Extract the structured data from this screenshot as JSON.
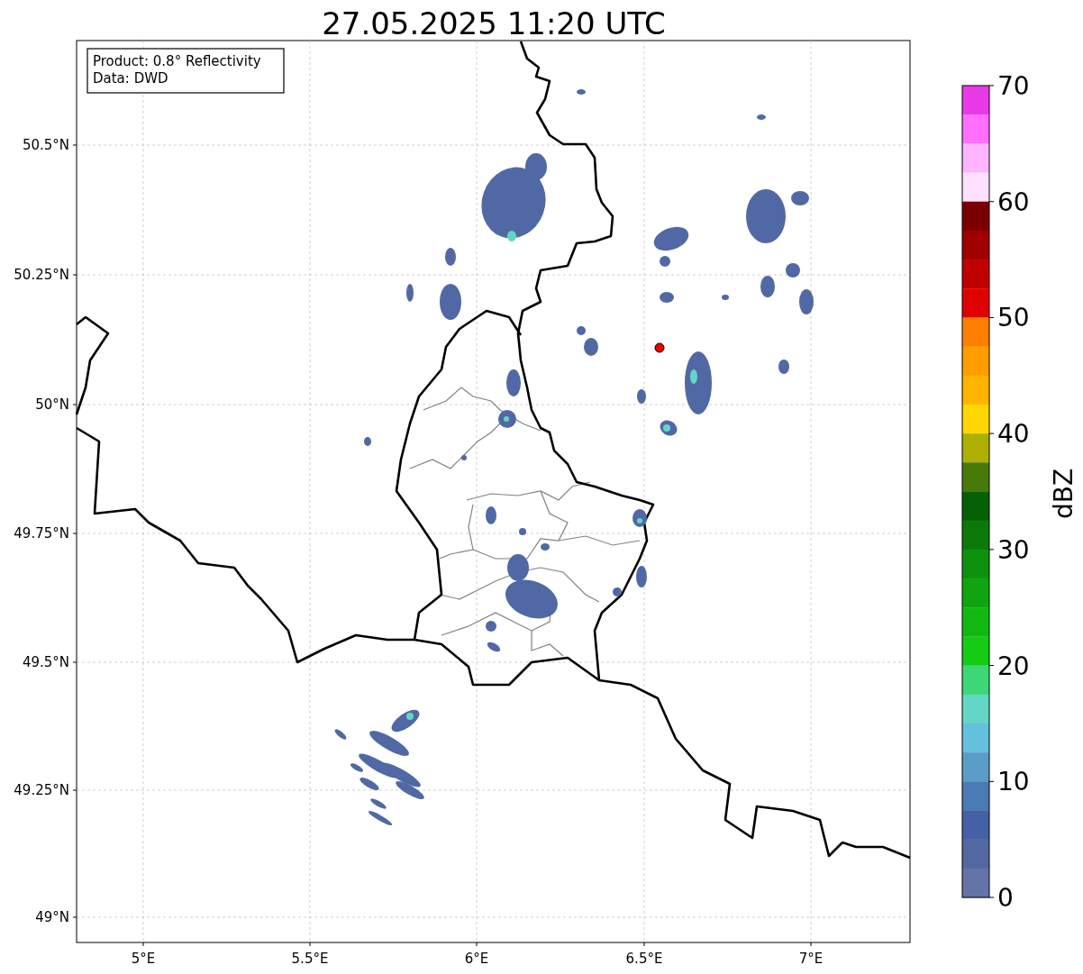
{
  "title": "27.05.2025 11:20 UTC",
  "legend": [
    "Product: 0.8° Reflectivity",
    "Data: DWD"
  ],
  "y_ticks": [
    "50.5°N",
    "50.25°N",
    "50°N",
    "49.75°N",
    "49.5°N",
    "49.25°N",
    "49°N"
  ],
  "x_ticks": [
    "5°E",
    "5.5°E",
    "6°E",
    "6.5°E",
    "7°E"
  ],
  "colorbar": {
    "label": "dBZ",
    "ticks": [
      "70",
      "60",
      "50",
      "40",
      "30",
      "20",
      "10",
      "0"
    ],
    "bands": [
      {
        "color": "#e83ae8"
      },
      {
        "color": "#ff6eff"
      },
      {
        "color": "#ffb4ff"
      },
      {
        "color": "#ffe0ff"
      },
      {
        "color": "#7a0000"
      },
      {
        "color": "#a00000"
      },
      {
        "color": "#c00000"
      },
      {
        "color": "#e00000"
      },
      {
        "color": "#ff7f00"
      },
      {
        "color": "#ff9c00"
      },
      {
        "color": "#ffb400"
      },
      {
        "color": "#ffd700"
      },
      {
        "color": "#adb000"
      },
      {
        "color": "#487a0a"
      },
      {
        "color": "#066006"
      },
      {
        "color": "#0b7a0b"
      },
      {
        "color": "#0e920e"
      },
      {
        "color": "#10a510"
      },
      {
        "color": "#12b812"
      },
      {
        "color": "#13cc13"
      },
      {
        "color": "#3dd775"
      },
      {
        "color": "#63d6c5"
      },
      {
        "color": "#64c0dc"
      },
      {
        "color": "#5a9ec8"
      },
      {
        "color": "#4a7bb4"
      },
      {
        "color": "#4560a6"
      },
      {
        "color": "#5367a0"
      },
      {
        "color": "#6574a8"
      }
    ]
  }
}
